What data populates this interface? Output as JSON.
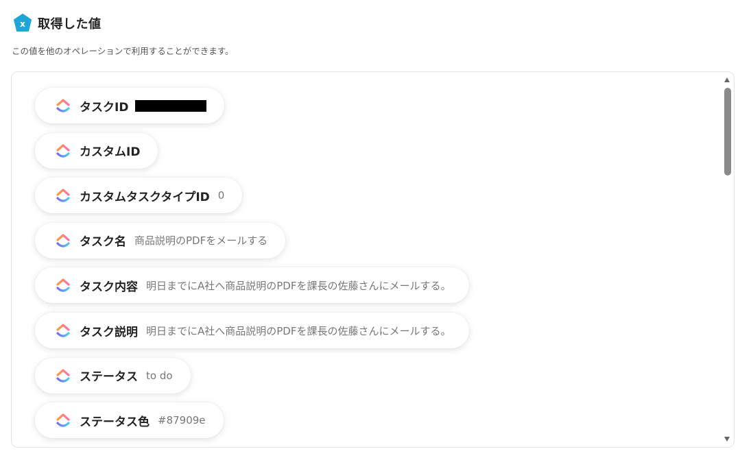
{
  "header": {
    "title": "取得した値",
    "icon": "variable-x-icon"
  },
  "description": "この値を他のオペレーションで利用することができます。",
  "items": [
    {
      "label": "タスクID",
      "value": "",
      "redacted": true,
      "icon": "clickup-logo-icon"
    },
    {
      "label": "カスタムID",
      "value": "",
      "icon": "clickup-logo-icon"
    },
    {
      "label": "カスタムタスクタイプID",
      "value": "0",
      "icon": "clickup-logo-icon"
    },
    {
      "label": "タスク名",
      "value": "商品説明のPDFをメールする",
      "icon": "clickup-logo-icon"
    },
    {
      "label": "タスク内容",
      "value": "明日までにA社へ商品説明のPDFを課長の佐藤さんにメールする。",
      "icon": "clickup-logo-icon"
    },
    {
      "label": "タスク説明",
      "value": "明日までにA社へ商品説明のPDFを課長の佐藤さんにメールする。",
      "icon": "clickup-logo-icon"
    },
    {
      "label": "ステータス",
      "value": "to do",
      "icon": "clickup-logo-icon"
    },
    {
      "label": "ステータス色",
      "value": "#87909e",
      "icon": "clickup-logo-icon"
    }
  ],
  "colors": {
    "header_icon": "#1fa6d8",
    "logo_gradient": [
      "#fd71af",
      "#ff9a3c",
      "#7b68ee",
      "#49ccf9"
    ]
  }
}
